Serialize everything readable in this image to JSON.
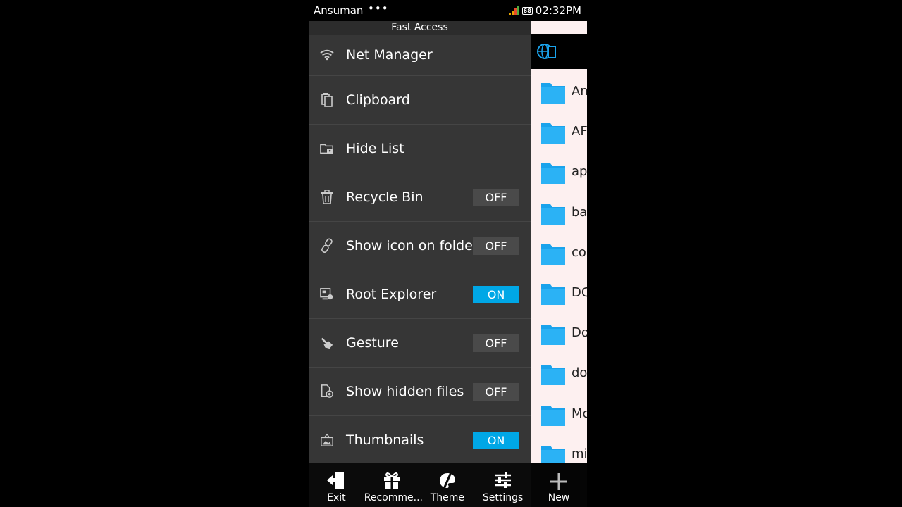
{
  "status": {
    "carrier": "Ansuman",
    "dots": "•••",
    "battery": "68",
    "time": "02:32PM"
  },
  "panel": {
    "title": "Fast Access",
    "items": [
      {
        "label": "Net Manager",
        "icon": "wifi-icon"
      },
      {
        "label": "Clipboard",
        "icon": "clipboard-icon"
      },
      {
        "label": "Hide List",
        "icon": "hidden-folder-icon"
      },
      {
        "label": "Recycle Bin",
        "icon": "trash-icon",
        "toggle": "OFF"
      },
      {
        "label": "Show icon on folder",
        "icon": "link-icon",
        "toggle": "OFF"
      },
      {
        "label": "Root Explorer",
        "icon": "root-icon",
        "toggle": "ON"
      },
      {
        "label": "Gesture",
        "icon": "hand-pointer-icon",
        "toggle": "OFF"
      },
      {
        "label": "Show hidden files",
        "icon": "hidden-file-icon",
        "toggle": "OFF"
      },
      {
        "label": "Thumbnails",
        "icon": "image-icon",
        "toggle": "ON"
      }
    ]
  },
  "folders": [
    "An",
    "AF",
    "ap",
    "ba",
    "co",
    "DC",
    "Do",
    "do",
    "Mc",
    "mi"
  ],
  "bottombar": {
    "exit": "Exit",
    "recommend": "Recomme...",
    "theme": "Theme",
    "settings": "Settings",
    "new": "New"
  },
  "colors": {
    "accent": "#00a7e6",
    "panel": "#363636",
    "folder": "#1aa3ec"
  }
}
